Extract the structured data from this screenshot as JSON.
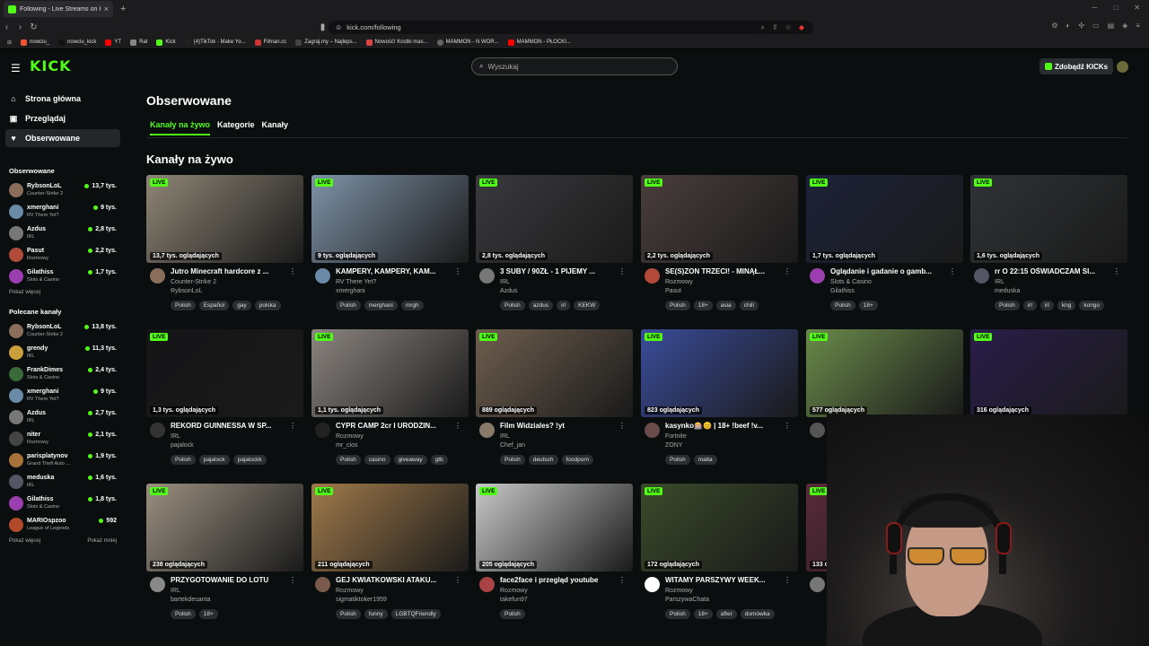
{
  "browser": {
    "tab_title": "Following - Live Streams on Kick",
    "url": "kick.com/following",
    "bookmarks": [
      "nowciu_",
      "nowciu_kick",
      "YT",
      "Rat",
      "Kick",
      "(4)TikTok - Make Yo...",
      "Filman.cc",
      "Zagraj.my – Najleps...",
      "Nowość! Kostki mas...",
      "MAMMON - N WOR...",
      "MAMMON - PŁOCKI..."
    ]
  },
  "header": {
    "logo": "KICK",
    "search_placeholder": "Wyszukaj",
    "get_kicks": "Zdobądź KICKs"
  },
  "sidebar": {
    "nav": [
      {
        "label": "Strona główna",
        "icon": "home-icon"
      },
      {
        "label": "Przeglądaj",
        "icon": "browse-icon"
      },
      {
        "label": "Obserwowane",
        "icon": "heart-icon"
      }
    ],
    "followed_title": "Obserwowane",
    "followed": [
      {
        "name": "RybsonLoL",
        "category": "Counter-Strike 2",
        "viewers": "13,7 tys.",
        "color": "#8a6d5a"
      },
      {
        "name": "xmerghani",
        "category": "RV There Yet?",
        "viewers": "9 tys.",
        "color": "#6a8aa8"
      },
      {
        "name": "Azdus",
        "category": "IRL",
        "viewers": "2,8 tys.",
        "color": "#777777"
      },
      {
        "name": "Pasut",
        "category": "Rozmowy",
        "viewers": "2,2 tys.",
        "color": "#b24a3a"
      },
      {
        "name": "Gilathiss",
        "category": "Slots & Casino",
        "viewers": "1,7 tys.",
        "color": "#9b3fb0"
      }
    ],
    "show_more": "Pokaż więcej",
    "recommended_title": "Polecane kanały",
    "recommended": [
      {
        "name": "RybsonLoL",
        "category": "Counter-Strike 2",
        "viewers": "13,8 tys.",
        "color": "#8a6d5a"
      },
      {
        "name": "grendy",
        "category": "IRL",
        "viewers": "11,3 tys.",
        "color": "#c9a03a"
      },
      {
        "name": "FrankDimes",
        "category": "Slots & Casino",
        "viewers": "2,4 tys.",
        "color": "#3a6a3a"
      },
      {
        "name": "xmerghani",
        "category": "RV There Yet?",
        "viewers": "9 tys.",
        "color": "#6a8aa8"
      },
      {
        "name": "Azdus",
        "category": "IRL",
        "viewers": "2,7 tys.",
        "color": "#777777"
      },
      {
        "name": "niter",
        "category": "Rozmowy",
        "viewers": "2,1 tys.",
        "color": "#444444"
      },
      {
        "name": "parisplatynov",
        "category": "Grand Theft Auto ...",
        "viewers": "1,9 tys.",
        "color": "#a8713a"
      },
      {
        "name": "meduska",
        "category": "IRL",
        "viewers": "1,6 tys.",
        "color": "#555566"
      },
      {
        "name": "Gilathiss",
        "category": "Slots & Casino",
        "viewers": "1,8 tys.",
        "color": "#9b3fb0"
      },
      {
        "name": "MARIOspzoo",
        "category": "League of Legends",
        "viewers": "592",
        "color": "#b04a2a"
      }
    ],
    "show_more_2": "Pokaż więcej",
    "show_less": "Pokaż mniej"
  },
  "main": {
    "title": "Obserwowane",
    "tabs": [
      "Kanały na żywo",
      "Kategorie",
      "Kanały"
    ],
    "section_title": "Kanały na żywo",
    "live_label": "LIVE",
    "cards": [
      {
        "viewers": "13,7 tys. oglądających",
        "title": "Jutro Minecraft hardcore z ...",
        "category": "Counter-Strike 2",
        "channel": "RybsonLoL",
        "tags": [
          "Polish",
          "Español",
          "gay",
          "polska"
        ],
        "bg": "#8f8676",
        "av": "#8a6d5a"
      },
      {
        "viewers": "9 tys. oglądających",
        "title": "KAMPERY, KAMPERY, KAM...",
        "category": "RV There Yet?",
        "channel": "xmerghani",
        "tags": [
          "Polish",
          "merghani",
          "mrgh"
        ],
        "bg": "#7e93a8",
        "av": "#6a8aa8"
      },
      {
        "viewers": "2,8 tys. oglądających",
        "title": "3 SUBY / 90ZŁ - 1 PIJEMY ...",
        "category": "IRL",
        "channel": "Azdus",
        "tags": [
          "Polish",
          "azdus",
          "irl",
          "KEKW"
        ],
        "bg": "#3a3a3e",
        "av": "#777777"
      },
      {
        "viewers": "2,2 tys. oglądających",
        "title": "SE(S)ZON TRZECI! - MINĄŁ...",
        "category": "Rozmowy",
        "channel": "Pasut",
        "tags": [
          "Polish",
          "18+",
          "asia",
          "chill"
        ],
        "bg": "#4a3e3c",
        "av": "#b24a3a"
      },
      {
        "viewers": "1,7 tys. oglądających",
        "title": "Oglądanie i gadanie o gamb...",
        "category": "Slots & Casino",
        "channel": "Gilathiss",
        "tags": [
          "Polish",
          "18+"
        ],
        "bg": "#1d2238",
        "av": "#9b3fb0"
      },
      {
        "viewers": "1,6 tys. oglądających",
        "title": "rr O 22:15 OŚWIADCZAM SI...",
        "category": "IRL",
        "channel": "meduska",
        "tags": [
          "Polish",
          "irl",
          "irl",
          "kng",
          "kongo"
        ],
        "bg": "#2f3336",
        "av": "#555566"
      },
      {
        "viewers": "1,3 tys. oglądających",
        "title": "REKORD GUINNESSA W SP...",
        "category": "IRL",
        "channel": "pajalock",
        "tags": [
          "Polish",
          "pajalock",
          "pajalockk"
        ],
        "bg": "#151517",
        "av": "#333333"
      },
      {
        "viewers": "1,1 tys. oglądających",
        "title": "CYPR CAMP 2cr I URODZIN...",
        "category": "Rozmowy",
        "channel": "mr_cios",
        "tags": [
          "Polish",
          "casino",
          "giveaway",
          "gtb"
        ],
        "bg": "#8c8580",
        "av": "#222222"
      },
      {
        "viewers": "889 oglądających",
        "title": "Film Widziales? !yt",
        "category": "IRL",
        "channel": "Chef_jan",
        "tags": [
          "Polish",
          "deutsch",
          "foodporn"
        ],
        "bg": "#6e5e4e",
        "av": "#8a7a6a"
      },
      {
        "viewers": "823 oglądających",
        "title": "kasynko🎰😊 | 18+ !beef !v...",
        "category": "Fortnite",
        "channel": "ZONY",
        "tags": [
          "Polish",
          "malta"
        ],
        "bg": "#3a4c9a",
        "av": "#6a4a4a"
      },
      {
        "viewers": "577 oglądających",
        "title": "",
        "category": "",
        "channel": "",
        "tags": [],
        "bg": "#6a8a4a",
        "av": "#555555"
      },
      {
        "viewers": "316 oglądających",
        "title": "",
        "category": "",
        "channel": "",
        "tags": [],
        "bg": "#2a1d4a",
        "av": "#555555"
      },
      {
        "viewers": "238 oglądających",
        "title": "PRZYGOTOWANIE DO LOTU",
        "category": "IRL",
        "channel": "bartekdesanta",
        "tags": [
          "Polish",
          "18+"
        ],
        "bg": "#9a8f80",
        "av": "#888888"
      },
      {
        "viewers": "211 oglądających",
        "title": "GEJ KWIATKOWSKI ATAKU...",
        "category": "Rozmowy",
        "channel": "sigmatiktoker1959",
        "tags": [
          "Polish",
          "funny",
          "LGBTQFriendly"
        ],
        "bg": "#a07a4a",
        "av": "#7a5a4a"
      },
      {
        "viewers": "205 oglądających",
        "title": "face2face i przegląd youtube",
        "category": "Rozmowy",
        "channel": "takefun97",
        "tags": [
          "Polish"
        ],
        "bg": "#c8c8c8",
        "av": "#aa4444"
      },
      {
        "viewers": "172 oglądających",
        "title": "WITAMY PARSZYWY WEEK...",
        "category": "Rozmowy",
        "channel": "ParszywaChata",
        "tags": [
          "Polish",
          "18+",
          "after",
          "domówka"
        ],
        "bg": "#3a4a2a",
        "av": "#ffffff"
      },
      {
        "viewers": "133 o",
        "title": "",
        "category": "",
        "channel": "",
        "tags": [],
        "bg": "#5a2a3a",
        "av": "#777777"
      }
    ]
  }
}
